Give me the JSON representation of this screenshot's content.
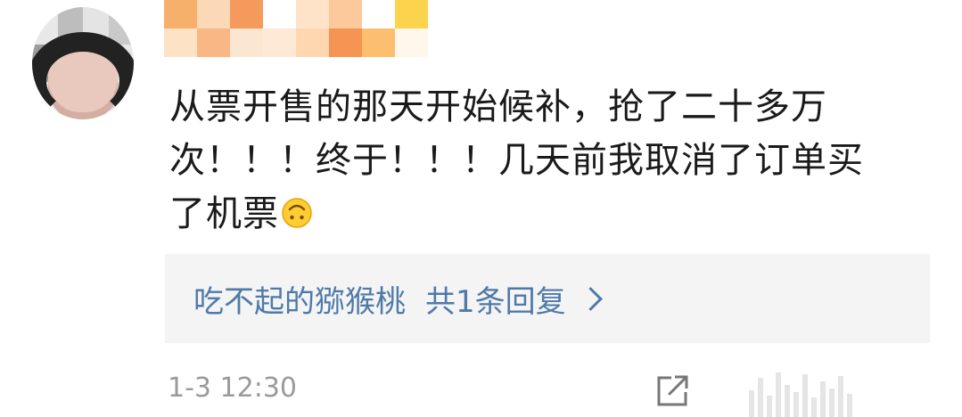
{
  "comment": {
    "text_line1": "从票开售的那天开始候补，抢了二十多万",
    "text_line2": "次！！！终于！！！几天前我取消了订单买",
    "text_line3": "了机票",
    "emoji": "upside-down-face"
  },
  "reply": {
    "user": "吃不起的猕猴桃",
    "count_text": "共1条回复"
  },
  "meta": {
    "timestamp": "1-3 12:30"
  },
  "icons": {
    "share": "share-icon"
  },
  "colors": {
    "link": "#4f7aa8",
    "text": "#1a1a1a",
    "muted": "#9a9a9a",
    "reply_bg": "#f4f4f4"
  }
}
